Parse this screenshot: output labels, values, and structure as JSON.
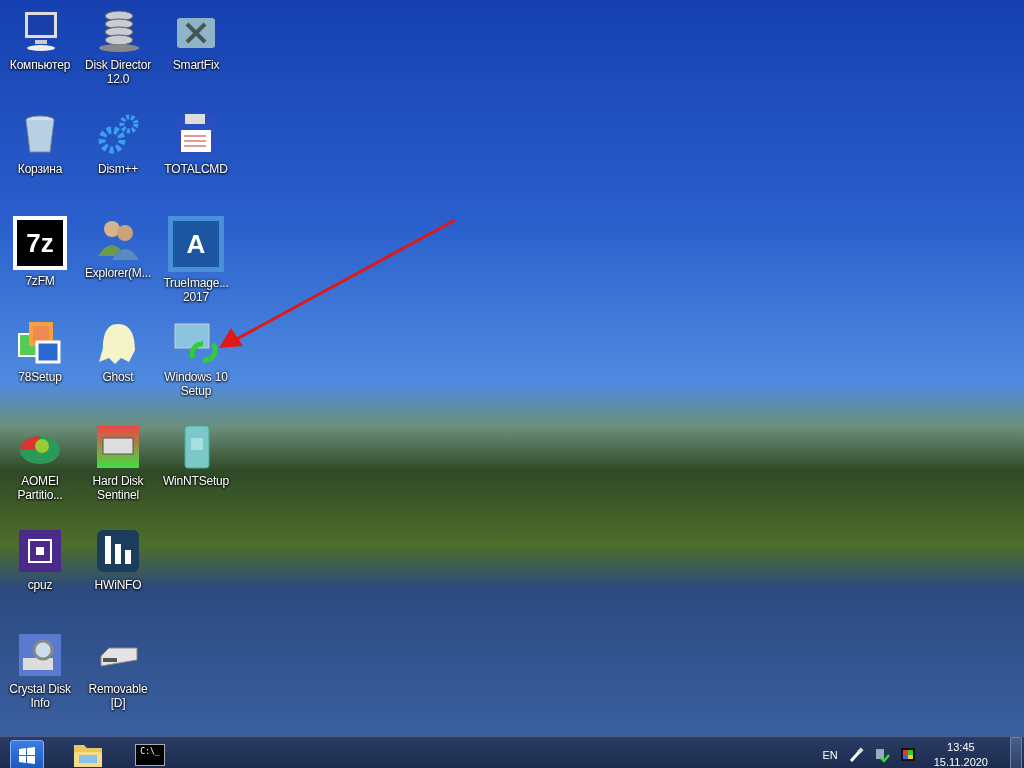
{
  "desktop": {
    "icon_rows": [
      [
        {
          "label": "Компьютер"
        },
        {
          "label": "Disk Director\n12.0"
        },
        {
          "label": "SmartFix"
        }
      ],
      [
        {
          "label": "Корзина"
        },
        {
          "label": "Dism++"
        },
        {
          "label": "TOTALCMD"
        }
      ],
      [
        {
          "label": "7zFM",
          "glyph": "7z"
        },
        {
          "label": "Explorer(M..."
        },
        {
          "label": "TrueImage...\n2017",
          "glyph": "A"
        }
      ],
      [
        {
          "label": "78Setup"
        },
        {
          "label": "Ghost"
        },
        {
          "label": "Windows 10\nSetup"
        }
      ],
      [
        {
          "label": "AOMEI\nPartitio..."
        },
        {
          "label": "Hard Disk\nSentinel"
        },
        {
          "label": "WinNTSetup"
        }
      ],
      [
        {
          "label": "cpuz"
        },
        {
          "label": "HWiNFO"
        }
      ],
      [
        {
          "label": "Crystal Disk\nInfo"
        },
        {
          "label": "Removable\n[D]"
        }
      ]
    ]
  },
  "taskbar": {
    "cmd_glyph": "C:\\_",
    "language": "EN",
    "time": "13:45",
    "date": "15.11.2020"
  }
}
